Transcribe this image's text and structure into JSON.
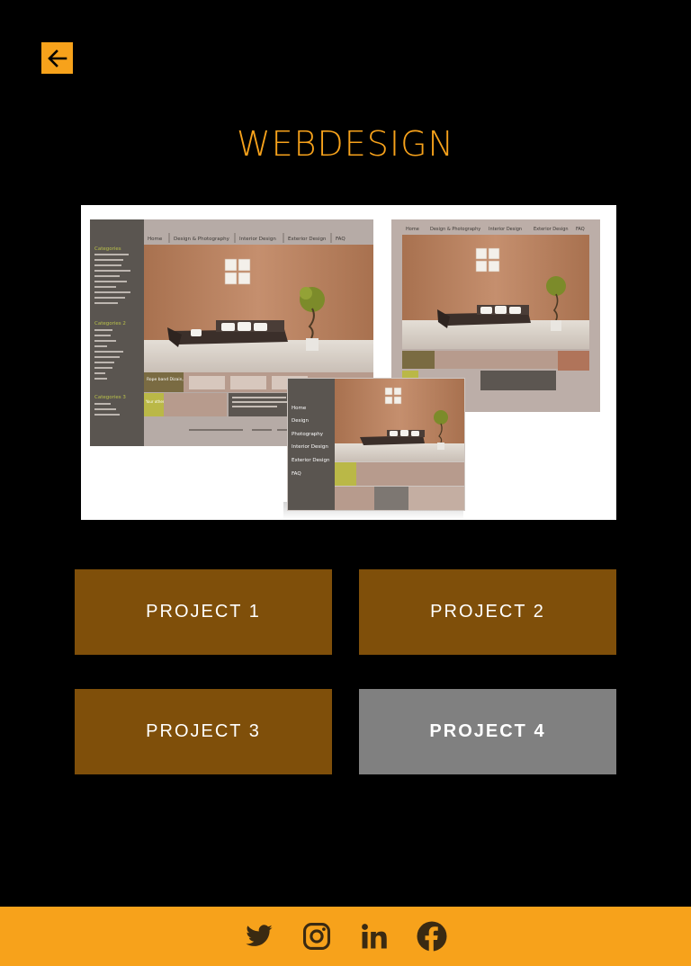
{
  "header": {
    "back_icon": "arrow-left-icon",
    "title": "WEBDESIGN"
  },
  "preview": {
    "desktop_nav": [
      "Home",
      "Design & Photography",
      "Interior Design",
      "Exterior Design",
      "FAQ"
    ],
    "tablet_nav": [
      "Home",
      "Design & Photography",
      "Interior Design",
      "Exterior Design",
      "FAQ"
    ],
    "mobile_menu": [
      "Home",
      "Design",
      "Photography",
      "Interior Design",
      "Exterior Design",
      "FAQ"
    ],
    "sidebar_headings": [
      "Categories",
      "Categories 2",
      "Categories 3"
    ],
    "promo_text": "Rope band Dizain, Interior and Join",
    "promo_small": "Your other visual"
  },
  "projects": [
    {
      "label": "PROJECT 1",
      "active": false
    },
    {
      "label": "PROJECT 2",
      "active": false
    },
    {
      "label": "PROJECT 3",
      "active": false
    },
    {
      "label": "PROJECT 4",
      "active": true
    }
  ],
  "footer": {
    "icons": [
      "twitter-icon",
      "instagram-icon",
      "linkedin-icon",
      "facebook-icon"
    ]
  },
  "colors": {
    "accent": "#f7a21b",
    "project_bg": "#7f4f0a",
    "active_bg": "#808080"
  }
}
